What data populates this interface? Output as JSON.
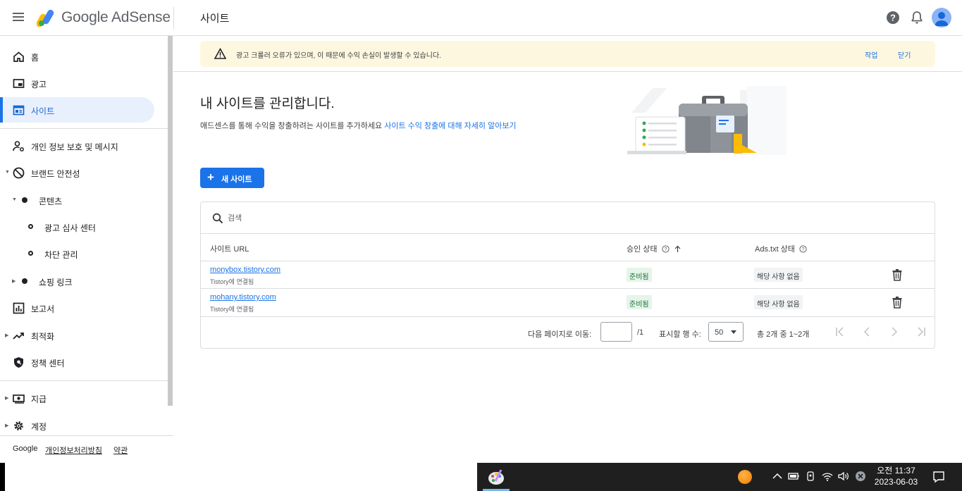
{
  "header": {
    "brand": "Google AdSense",
    "page_title": "사이트"
  },
  "sidebar": {
    "items": [
      {
        "label": "홈"
      },
      {
        "label": "광고"
      },
      {
        "label": "사이트"
      },
      {
        "label": "개인 정보 보호 및 메시지"
      },
      {
        "label": "브랜드 안전성"
      },
      {
        "label": "콘텐츠"
      },
      {
        "label": "광고 심사 센터"
      },
      {
        "label": "차단 관리"
      },
      {
        "label": "쇼핑 링크"
      },
      {
        "label": "보고서"
      },
      {
        "label": "최적화"
      },
      {
        "label": "정책 센터"
      },
      {
        "label": "지급"
      },
      {
        "label": "계정"
      }
    ],
    "footer": {
      "google": "Google",
      "privacy": "개인정보처리방침",
      "terms": "약관"
    }
  },
  "banner": {
    "message": "광고 크롤러 오류가 있으며, 이 때문에 수익 손실이 발생할 수 있습니다.",
    "action": "작업",
    "dismiss": "닫기"
  },
  "main": {
    "title": "내 사이트를 관리합니다.",
    "subtitle": "애드센스를 통해 수익을 창출하려는 사이트를 추가하세요",
    "subtitle_link": "사이트 수익 창출에 대해 자세히 알아보기",
    "new_site_label": "새 사이트"
  },
  "table": {
    "search_placeholder": "검색",
    "headers": {
      "url": "사이트 URL",
      "approval": "승인 상태",
      "ads_txt": "Ads.txt 상태"
    },
    "rows": [
      {
        "url": "monybox.tistory.com",
        "connected": "Tistory에 연결됨",
        "status": "준비됨",
        "ads_txt": "해당 사항 없음"
      },
      {
        "url": "mohany.tistory.com",
        "connected": "Tistory에 연결됨",
        "status": "준비됨",
        "ads_txt": "해당 사항 없음"
      }
    ],
    "pager": {
      "goto_label": "다음 페이지로 이동:",
      "total_pages": "/1",
      "rows_label": "표시할 행 수:",
      "rows_value": "50",
      "range": "총 2개 중 1~2개"
    }
  },
  "taskbar": {
    "time": "오전 11:37",
    "date": "2023-06-03"
  },
  "colors": {
    "accent": "#1a73e8",
    "banner_bg": "#fef7e0",
    "status_ready_bg": "#e6f4ea",
    "status_ready_text": "#137333"
  }
}
